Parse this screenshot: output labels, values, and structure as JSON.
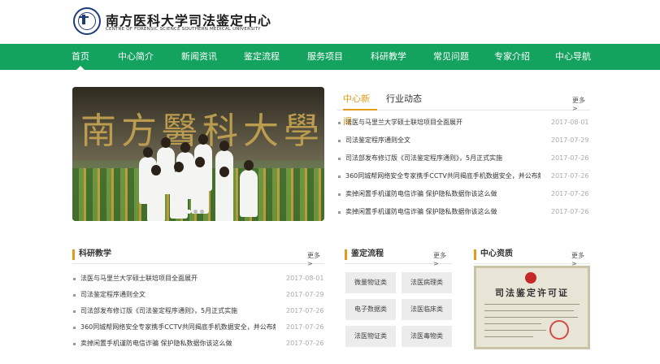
{
  "header": {
    "title": "南方医科大学司法鉴定中心",
    "subtitle": "CENTRE OF FORENSIC SCIENCE SOUTHERN MEDICAL UNIVERSITY"
  },
  "nav": {
    "items": [
      "首页",
      "中心简介",
      "新闻资讯",
      "鉴定流程",
      "服务项目",
      "科研教学",
      "常见问题",
      "专家介绍",
      "中心导航"
    ],
    "active": "首页"
  },
  "hero": {
    "calligraphy": "南方醫科大學",
    "slide_count": 3,
    "active_slide": 1
  },
  "news": {
    "tabs": [
      "中心新闻",
      "行业动态"
    ],
    "active_tab": "中心新闻",
    "more": "更多 >",
    "items": [
      {
        "title": "法医与马里兰大学硕士联培项目全面展开",
        "date": "2017-08-01"
      },
      {
        "title": "司法鉴定程序通则全文",
        "date": "2017-07-29"
      },
      {
        "title": "司法部发布修订版《司法鉴定程序通则》，5月正式实施",
        "date": "2017-07-26"
      },
      {
        "title": "360同城帮网络安全专家携手CCTV共同揭底手机数据安全，并公布解...",
        "date": "2017-07-26"
      },
      {
        "title": "卖掉闲置手机谨防电信诈骗 保护隐私数据你该这么做",
        "date": "2017-07-26"
      },
      {
        "title": "卖掉闲置手机谨防电信诈骗 保护隐私数据你该这么做",
        "date": "2017-07-26"
      }
    ]
  },
  "research": {
    "heading": "科研教学",
    "more": "更多 >",
    "items": [
      {
        "title": "法医与马里兰大学硕士联培项目全面展开",
        "date": "2017-08-01"
      },
      {
        "title": "司法鉴定程序通则全文",
        "date": "2017-07-29"
      },
      {
        "title": "司法部发布修订版《司法鉴定程序通则》，5月正式实施",
        "date": "2017-07-26"
      },
      {
        "title": "360同城帮网络安全专家携手CCTV共同揭底手机数据安全，并公布解...",
        "date": "2017-07-26"
      },
      {
        "title": "卖掉闲置手机谨防电信诈骗 保护隐私数据你该这么做",
        "date": "2017-07-26"
      }
    ]
  },
  "process": {
    "heading": "鉴定流程",
    "more": "更多 >",
    "buttons": [
      "微量物证类",
      "法医病理类",
      "电子数据类",
      "法医临床类",
      "法医物证类",
      "法医毒物类"
    ]
  },
  "qualification": {
    "heading": "中心资质",
    "more": "更多 >",
    "certificate_title": "司法鉴定许可证"
  },
  "colors": {
    "nav_green": "#14a35f",
    "accent_orange": "#e49b1a",
    "date_gray": "#aaaaaa"
  }
}
